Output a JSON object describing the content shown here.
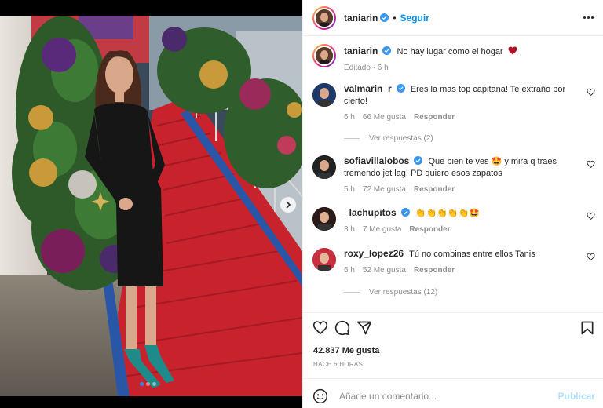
{
  "post": {
    "username": "taniarin",
    "follow_label": "Seguir",
    "separator": "•",
    "caption": "No hay lugar como el hogar",
    "caption_emoji": "heart",
    "edited": "Editado · 6 h"
  },
  "comments": [
    {
      "user": "valmarin_r",
      "text": "Eres la mas top capitana! Te extraño por cierto!",
      "time": "6 h",
      "likes": "66 Me gusta",
      "reply": "Responder",
      "view_replies": "Ver respuestas (2)"
    },
    {
      "user": "sofiavillalobos",
      "text": "Que bien te ves 🤩 y mira q traes tremendo jet lag! PD quiero esos zapatos",
      "time": "5 h",
      "likes": "72 Me gusta",
      "reply": "Responder"
    },
    {
      "user": "_lachupitos",
      "text": "👏👏👏👏👏🤩",
      "time": "3 h",
      "likes": "7 Me gusta",
      "reply": "Responder"
    },
    {
      "user": "roxy_lopez26",
      "text": "Tú no combinas entre ellos Tanis",
      "time": "6 h",
      "likes": "52 Me gusta",
      "reply": "Responder",
      "view_replies": "Ver respuestas (12)"
    }
  ],
  "stats": {
    "likes": "42.837 Me gusta",
    "time_ago": "HACE 6 HORAS"
  },
  "add_comment": {
    "placeholder": "Añade un comentario...",
    "publish": "Publicar"
  },
  "icons": [
    "more-icon",
    "verified-icon",
    "heart-icon",
    "comment-icon",
    "share-icon",
    "save-icon",
    "emoji-icon",
    "next-arrow-icon"
  ],
  "colors": {
    "link": "#0095f6",
    "muted": "#8e8e8e",
    "verified": "#3897f0",
    "carpet": "#c8232c"
  },
  "carousel": {
    "slides": 3,
    "active_index": 1
  }
}
